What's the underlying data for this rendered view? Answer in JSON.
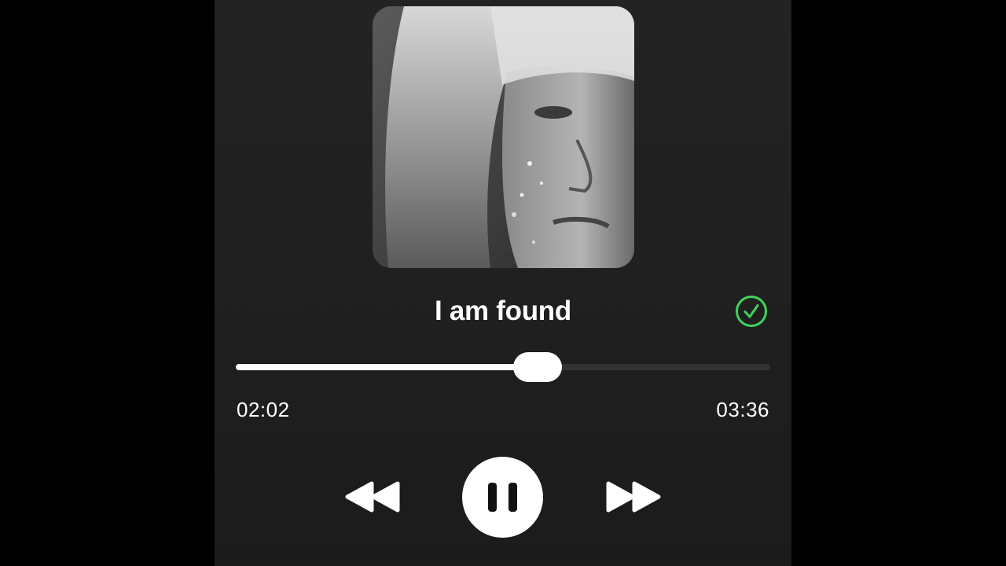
{
  "player": {
    "track_title": "I am found",
    "elapsed_time": "02:02",
    "total_time": "03:36",
    "progress_fraction": 0.565,
    "saved": true
  },
  "icons": {
    "saved": "check-circle-icon",
    "rewind": "rewind-icon",
    "pause": "pause-icon",
    "forward": "fast-forward-icon"
  },
  "colors": {
    "background": "#000000",
    "panel": "#222222",
    "accent_green": "#3fd35a",
    "foreground": "#ffffff",
    "track": "#333333"
  }
}
